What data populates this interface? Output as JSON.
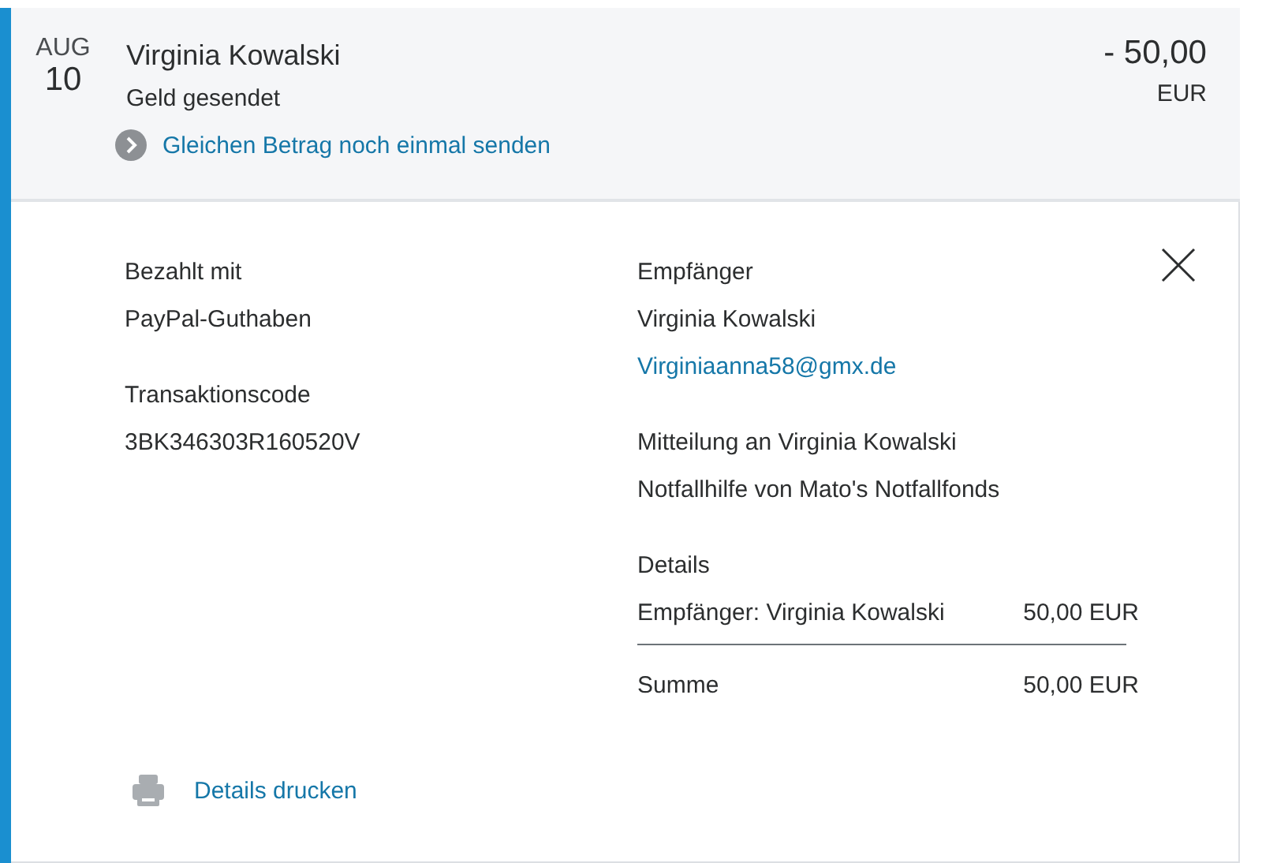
{
  "transaction": {
    "month": "AUG",
    "day": "10",
    "name": "Virginia Kowalski",
    "status": "Geld gesendet",
    "repeat_link": "Gleichen Betrag noch einmal senden",
    "amount": "- 50,00",
    "currency": "EUR",
    "expanded": true
  },
  "details": {
    "left": [
      {
        "label": "Bezahlt mit",
        "value": "PayPal-Guthaben"
      },
      {
        "label": "Transaktionscode",
        "value": "3BK346303R160520V"
      }
    ],
    "recipient": {
      "label": "Empfänger",
      "name": "Virginia Kowalski",
      "email": "Virginiaanna58@gmx.de"
    },
    "message": {
      "label": "Mitteilung an Virginia Kowalski",
      "text": "Notfallhilfe von Mato's Notfallfonds"
    },
    "breakdown": {
      "label": "Details",
      "rows": [
        {
          "label": "Empfänger: Virginia Kowalski",
          "value": "50,00 EUR"
        }
      ],
      "total_label": "Summe",
      "total_value": "50,00 EUR"
    },
    "print_link": "Details drucken"
  }
}
